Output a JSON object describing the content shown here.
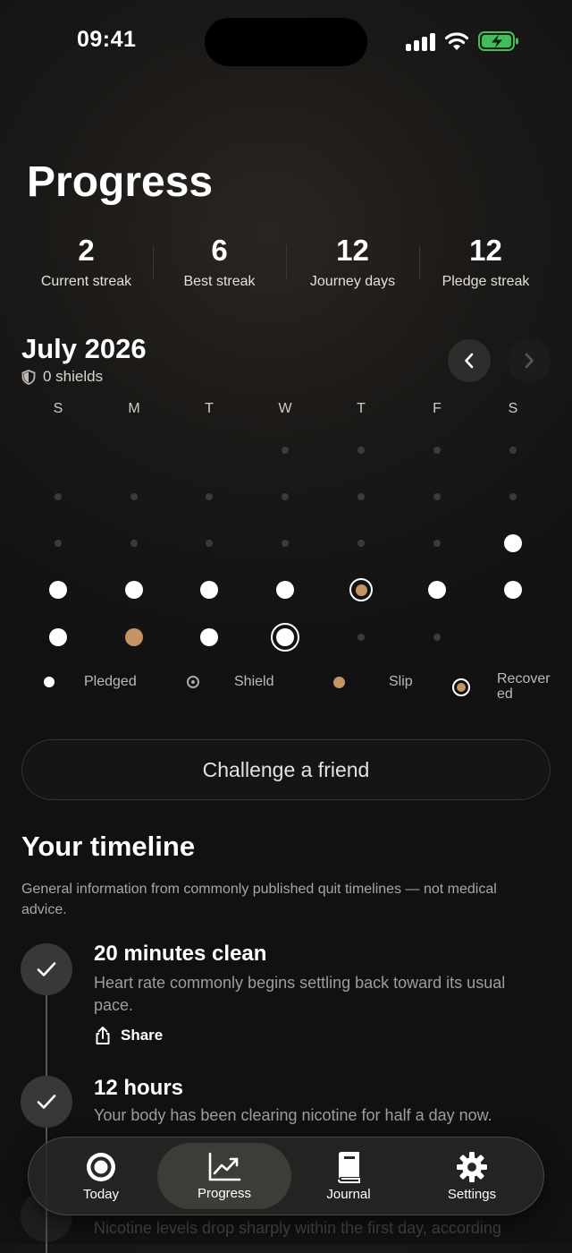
{
  "status": {
    "time": "09:41"
  },
  "page": {
    "title": "Progress"
  },
  "stats": [
    {
      "value": "2",
      "label": "Current streak"
    },
    {
      "value": "6",
      "label": "Best streak"
    },
    {
      "value": "12",
      "label": "Journey days"
    },
    {
      "value": "12",
      "label": "Pledge streak"
    }
  ],
  "calendar": {
    "month": "July 2026",
    "shields": "0 shields",
    "weekdays": [
      "S",
      "M",
      "T",
      "W",
      "T",
      "F",
      "S"
    ],
    "weeks": [
      [
        "none",
        "none",
        "none",
        "empty",
        "empty",
        "empty",
        "empty"
      ],
      [
        "empty",
        "empty",
        "empty",
        "empty",
        "empty",
        "empty",
        "empty"
      ],
      [
        "empty",
        "empty",
        "empty",
        "empty",
        "empty",
        "empty",
        "pledged"
      ],
      [
        "pledged",
        "pledged",
        "pledged",
        "pledged",
        "recovered",
        "pledged",
        "pledged"
      ],
      [
        "pledged",
        "slip",
        "pledged",
        "today",
        "empty",
        "empty",
        "none"
      ]
    ]
  },
  "legend": {
    "pledged": "Pledged",
    "shield": "Shield",
    "slip": "Slip",
    "recovered": "Recover\ned"
  },
  "challenge_label": "Challenge a friend",
  "timeline": {
    "title": "Your timeline",
    "subtitle": "General information from commonly published quit timelines — not medical advice.",
    "m1_title": "20 minutes clean",
    "m1_text": "Heart rate commonly begins settling back toward its usual pace.",
    "share_label": "Share",
    "m2_title": "12 hours",
    "m2_text": "Your body has been clearing nicotine for half a day now.",
    "m3_text": "Nicotine levels drop sharply within the first day, according"
  },
  "tabs": {
    "today": "Today",
    "progress": "Progress",
    "journal": "Journal",
    "settings": "Settings"
  }
}
